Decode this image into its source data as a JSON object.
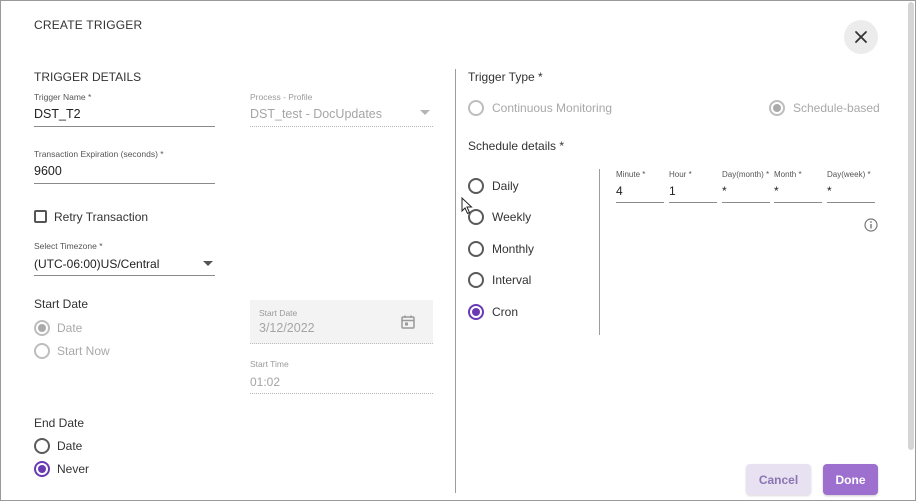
{
  "dialog": {
    "title": "CREATE TRIGGER",
    "close_label": "✕"
  },
  "trigger_details": {
    "heading": "TRIGGER DETAILS",
    "trigger_name_label": "Trigger Name *",
    "trigger_name_value": "DST_T2",
    "process_profile_label": "Process - Profile",
    "process_profile_value": "DST_test - DocUpdates",
    "expiration_label": "Transaction Expiration (seconds) *",
    "expiration_value": "9600",
    "retry_label": "Retry Transaction",
    "retry_checked": false,
    "timezone_label": "Select Timezone *",
    "timezone_value": "(UTC-06:00)US/Central"
  },
  "start_date": {
    "heading": "Start Date",
    "options": [
      "Date",
      "Start Now"
    ],
    "selected": "Date",
    "date_field_label": "Start Date",
    "date_field_value": "3/12/2022",
    "time_field_label": "Start Time",
    "time_field_value": "01:02"
  },
  "end_date": {
    "heading": "End Date",
    "options": [
      "Date",
      "Never"
    ],
    "selected": "Never"
  },
  "trigger_type": {
    "heading": "Trigger Type *",
    "options": [
      "Continuous Monitoring",
      "Schedule-based"
    ],
    "selected": "Schedule-based"
  },
  "schedule": {
    "heading": "Schedule details *",
    "options": [
      "Daily",
      "Weekly",
      "Monthly",
      "Interval",
      "Cron"
    ],
    "selected": "Cron",
    "cron_fields": [
      {
        "label": "Minute *",
        "value": "4"
      },
      {
        "label": "Hour *",
        "value": "1"
      },
      {
        "label": "Day(month) *",
        "value": "*"
      },
      {
        "label": "Month *",
        "value": "*"
      },
      {
        "label": "Day(week) *",
        "value": "*"
      }
    ]
  },
  "footer": {
    "cancel_label": "Cancel",
    "done_label": "Done"
  },
  "colors": {
    "accent": "#6a3ab2",
    "done_button": "#9d70cf",
    "cancel_button": "#e8e1f1"
  }
}
